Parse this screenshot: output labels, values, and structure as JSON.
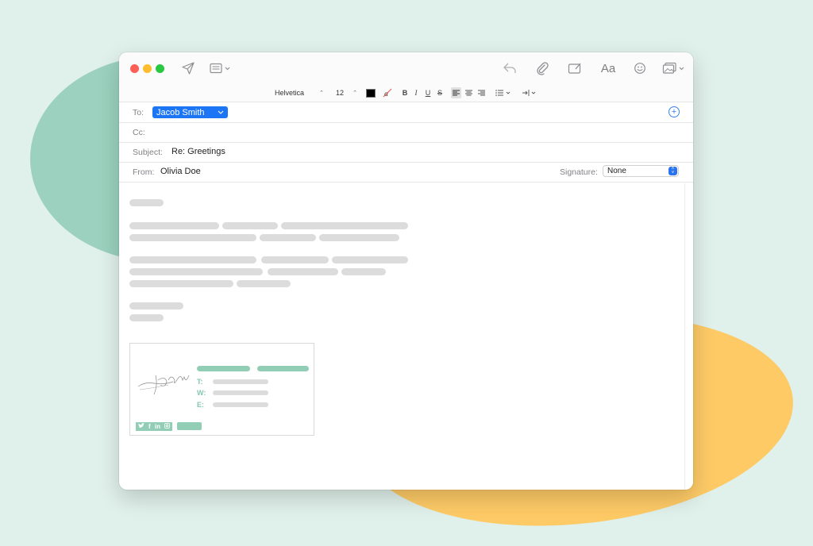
{
  "format_bar": {
    "font": "Helvetica",
    "size": "12",
    "bold": "B",
    "italic": "I",
    "underline": "U",
    "strike": "S"
  },
  "header": {
    "to_label": "To:",
    "to_recipient": "Jacob Smith",
    "cc_label": "Cc:",
    "subject_label": "Subject:",
    "subject_value": "Re: Greetings",
    "from_label": "From:",
    "from_value": "Olivia Doe",
    "signature_label": "Signature:",
    "signature_value": "None"
  },
  "toolbar": {
    "font_button_label": "Aa"
  },
  "signature_card": {
    "phone_label": "T:",
    "web_label": "W:",
    "email_label": "E:"
  },
  "colors": {
    "accent": "#1c75f5",
    "signature_green": "#92cdb6",
    "background": "#e0f0ea",
    "blob_green": "#9bd1be",
    "blob_yellow": "#fdca66"
  }
}
